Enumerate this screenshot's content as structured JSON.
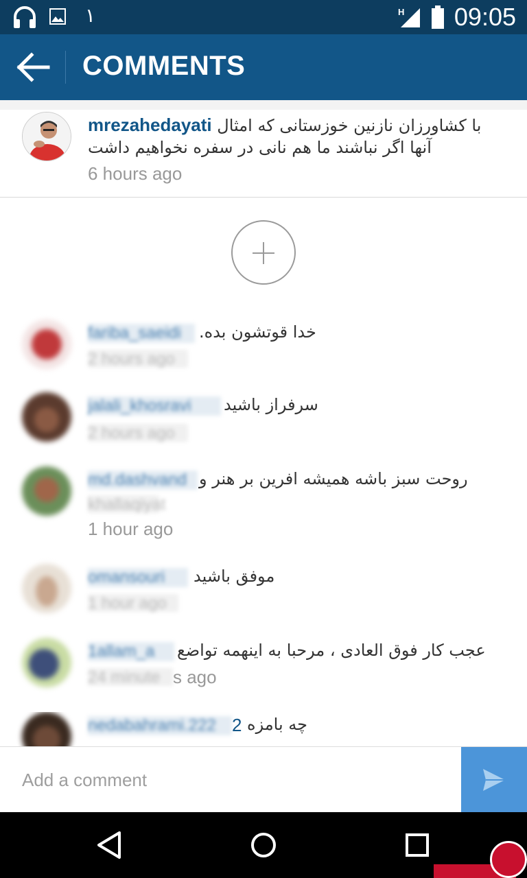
{
  "status_bar": {
    "time": "09:05",
    "notification_text": "۱",
    "network": "H"
  },
  "app_bar": {
    "title": "COMMENTS"
  },
  "caption": {
    "username": "mrezahedayati",
    "text": "با کشاورزان نازنین خوزستانی که امثال آنها اگر نباشند ما هم نانی در سفره نخواهیم داشت",
    "time": "6 hours ago"
  },
  "comments": [
    {
      "text": "خدا قوتشون بده.",
      "time": ""
    },
    {
      "text": "سرفراز باشید",
      "time": ""
    },
    {
      "text": "روحت سبز باشه همیشه افرین بر هنر و",
      "time": "1 hour ago"
    },
    {
      "text": "موفق باشید",
      "time": ""
    },
    {
      "text": "عجب کار فوق العادی ، مرحبا به اینهمه تواضع",
      "time_suffix": "s ago"
    },
    {
      "text": "چه بامزه",
      "name_tail": "2"
    }
  ],
  "input": {
    "placeholder": "Add a comment"
  },
  "colors": {
    "status_bar": "#0d3d5f",
    "app_bar": "#125688",
    "username": "#125688",
    "send_button": "#4c95d9",
    "nav_bar": "#000000"
  },
  "icons": {
    "status": [
      "headphones-icon",
      "image-icon",
      "signal-icon",
      "battery-icon"
    ],
    "nav": [
      "back-triangle-icon",
      "home-circle-icon",
      "recents-square-icon"
    ],
    "send": "send-icon"
  }
}
